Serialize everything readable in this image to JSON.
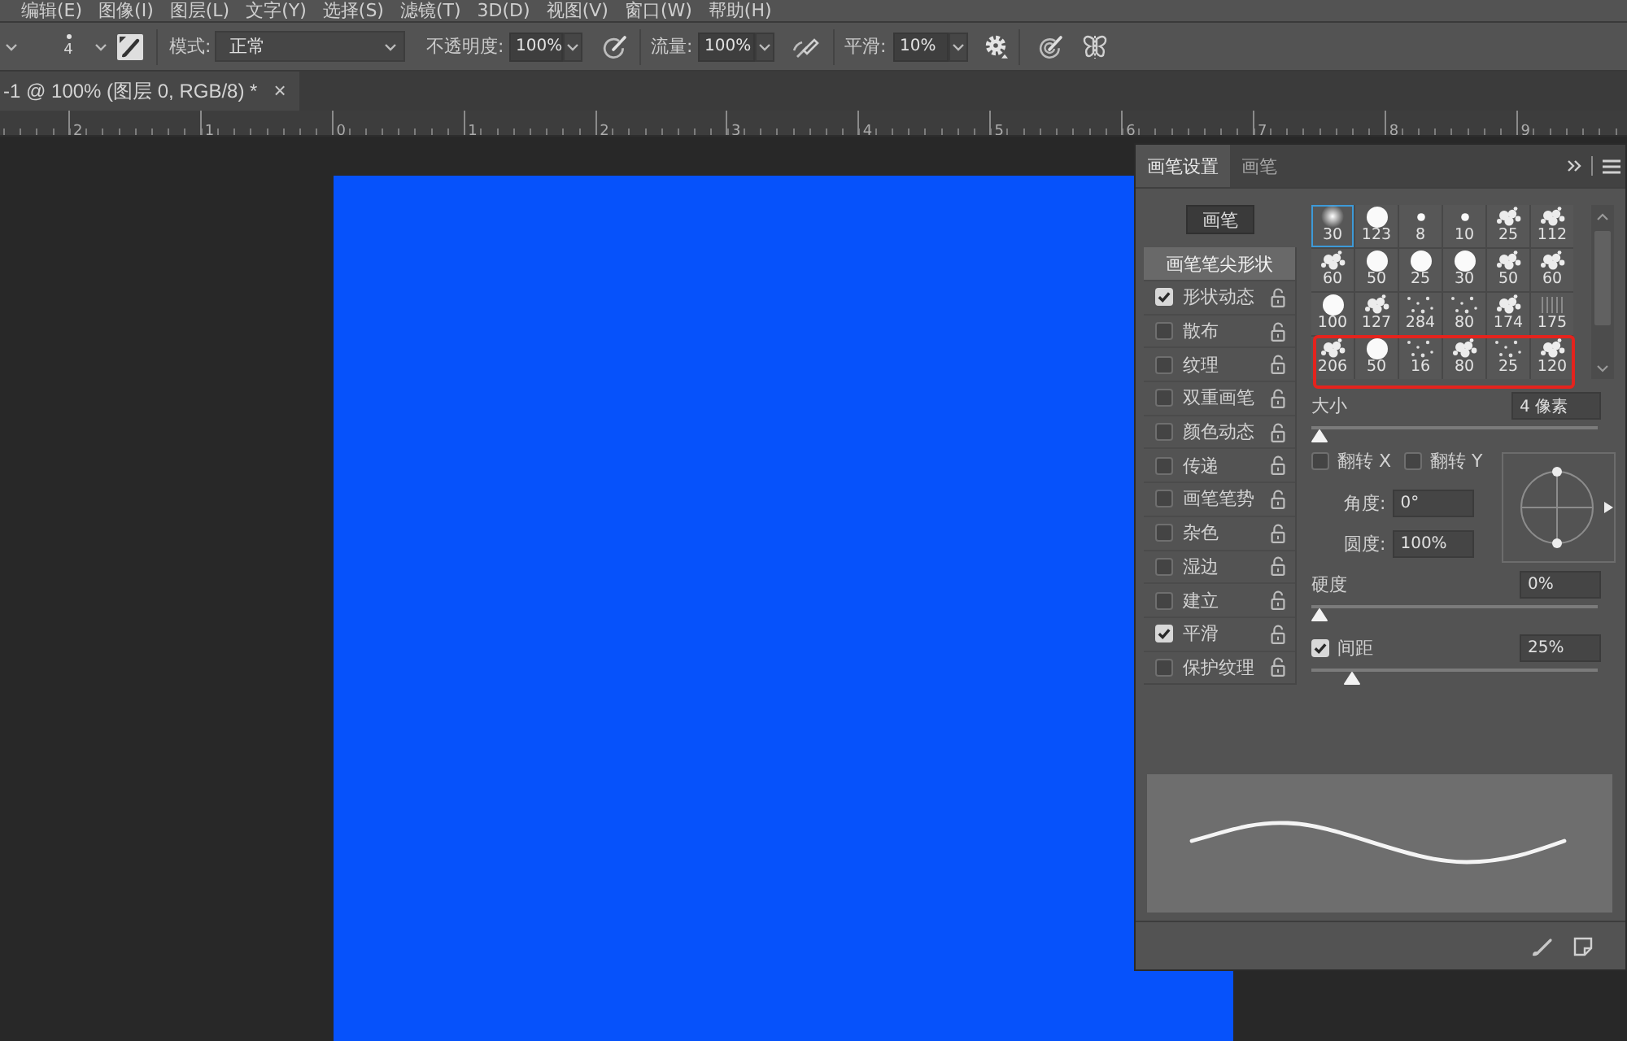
{
  "menu_bar": [
    "编辑(E)",
    "图像(I)",
    "图层(L)",
    "文字(Y)",
    "选择(S)",
    "滤镜(T)",
    "3D(D)",
    "视图(V)",
    "窗口(W)",
    "帮助(H)"
  ],
  "options_bar": {
    "brush_size": "4",
    "mode": {
      "label": "模式:",
      "value": "正常"
    },
    "opacity": {
      "label": "不透明度:",
      "value": "100%"
    },
    "flow": {
      "label": "流量:",
      "value": "100%"
    },
    "smoothing": {
      "label": "平滑:",
      "value": "10%"
    }
  },
  "document_tab": {
    "title": "-1 @ 100% (图层 0, RGB/8) *",
    "close": "×"
  },
  "ruler": {
    "labels": [
      "2",
      "1",
      "0",
      "1",
      "2",
      "3",
      "4",
      "5",
      "6",
      "7",
      "8",
      "9"
    ]
  },
  "brush_panel": {
    "tabs": [
      {
        "label": "画笔设置",
        "selected": true
      },
      {
        "label": "画笔",
        "selected": false
      }
    ],
    "brushes_button": "画笔",
    "sections": [
      {
        "kind": "tip-shape",
        "label": "画笔笔尖形状",
        "selected": true
      },
      {
        "kind": "option",
        "label": "形状动态",
        "checked": true,
        "selected": false
      },
      {
        "kind": "option",
        "label": "散布",
        "checked": false,
        "selected": false
      },
      {
        "kind": "option",
        "label": "纹理",
        "checked": false,
        "selected": false
      },
      {
        "kind": "option",
        "label": "双重画笔",
        "checked": false,
        "selected": false
      },
      {
        "kind": "option",
        "label": "颜色动态",
        "checked": false,
        "selected": false
      },
      {
        "kind": "option",
        "label": "传递",
        "checked": false,
        "selected": false
      },
      {
        "kind": "option",
        "label": "画笔笔势",
        "checked": false,
        "selected": false
      },
      {
        "kind": "option",
        "label": "杂色",
        "checked": false,
        "selected": false
      },
      {
        "kind": "option",
        "label": "湿边",
        "checked": false,
        "selected": false
      },
      {
        "kind": "option",
        "label": "建立",
        "checked": false,
        "selected": false
      },
      {
        "kind": "option",
        "label": "平滑",
        "checked": true,
        "selected": false
      },
      {
        "kind": "option",
        "label": "保护纹理",
        "checked": false,
        "selected": false
      }
    ],
    "preset_rows": [
      {
        "highlighted": false,
        "presets": [
          {
            "size": "30",
            "kind": "soft",
            "selected": true
          },
          {
            "size": "123",
            "kind": "hard",
            "selected": false
          },
          {
            "size": "8",
            "kind": "dot",
            "selected": false
          },
          {
            "size": "10",
            "kind": "dot",
            "selected": false
          },
          {
            "size": "25",
            "kind": "splatter",
            "selected": false
          },
          {
            "size": "112",
            "kind": "splatter",
            "selected": false
          }
        ]
      },
      {
        "highlighted": false,
        "presets": [
          {
            "size": "60",
            "kind": "splatter",
            "selected": false
          },
          {
            "size": "50",
            "kind": "hard",
            "selected": false
          },
          {
            "size": "25",
            "kind": "hard",
            "selected": false
          },
          {
            "size": "30",
            "kind": "hard",
            "selected": false
          },
          {
            "size": "50",
            "kind": "splatter",
            "selected": false
          },
          {
            "size": "60",
            "kind": "splatter",
            "selected": false
          }
        ]
      },
      {
        "highlighted": false,
        "presets": [
          {
            "size": "100",
            "kind": "hard",
            "selected": false
          },
          {
            "size": "127",
            "kind": "splatter",
            "selected": false
          },
          {
            "size": "284",
            "kind": "scatter",
            "selected": false
          },
          {
            "size": "80",
            "kind": "scatter",
            "selected": false
          },
          {
            "size": "174",
            "kind": "splatter",
            "selected": false
          },
          {
            "size": "175",
            "kind": "faint",
            "selected": false
          }
        ]
      },
      {
        "highlighted": true,
        "presets": [
          {
            "size": "206",
            "kind": "splatter",
            "selected": false
          },
          {
            "size": "50",
            "kind": "hard",
            "selected": false
          },
          {
            "size": "16",
            "kind": "scatter",
            "selected": false
          },
          {
            "size": "80",
            "kind": "splatter",
            "selected": false
          },
          {
            "size": "25",
            "kind": "scatter",
            "selected": false
          },
          {
            "size": "120",
            "kind": "splatter",
            "selected": false
          }
        ]
      }
    ],
    "size": {
      "label": "大小",
      "value": "4 像素",
      "level": 0
    },
    "flip": [
      {
        "label": "翻转 X",
        "checked": false
      },
      {
        "label": "翻转 Y",
        "checked": false
      }
    ],
    "angle": {
      "label": "角度:",
      "value": "0°"
    },
    "roundness": {
      "label": "圆度:",
      "value": "100%"
    },
    "hardness": {
      "label": "硬度",
      "value": "0%",
      "level": 0
    },
    "spacing": {
      "label": "间距",
      "checked": true,
      "value": "25%",
      "level": 0.12
    }
  }
}
